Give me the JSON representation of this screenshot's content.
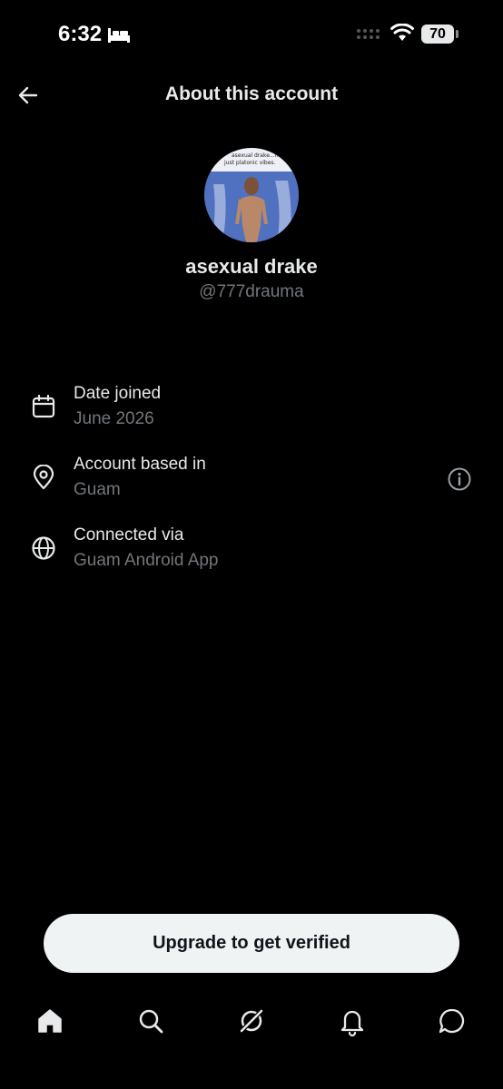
{
  "status_bar": {
    "time": "6:32",
    "battery": "70"
  },
  "header": {
    "title": "About this account",
    "back_icon": "arrow-left-icon"
  },
  "profile": {
    "display_name": "asexual drake",
    "handle": "@777drauma",
    "avatar_caption_line1": "asexual drake...no di",
    "avatar_caption_line2": "just platonic vibes."
  },
  "info_rows": [
    {
      "icon": "calendar-icon",
      "label": "Date joined",
      "value": "June 2026"
    },
    {
      "icon": "location-pin-icon",
      "label": "Account based in",
      "value": "Guam",
      "has_info": true
    },
    {
      "icon": "globe-icon",
      "label": "Connected via",
      "value": "Guam Android App"
    }
  ],
  "cta": {
    "label": "Upgrade to get verified"
  },
  "bottom_nav": [
    "home-icon",
    "search-icon",
    "grok-icon",
    "bell-icon",
    "messages-icon"
  ],
  "colors": {
    "background": "#000000",
    "primary_text": "#e7e9ea",
    "secondary_text": "#71767b",
    "button_bg": "#eff3f4"
  }
}
